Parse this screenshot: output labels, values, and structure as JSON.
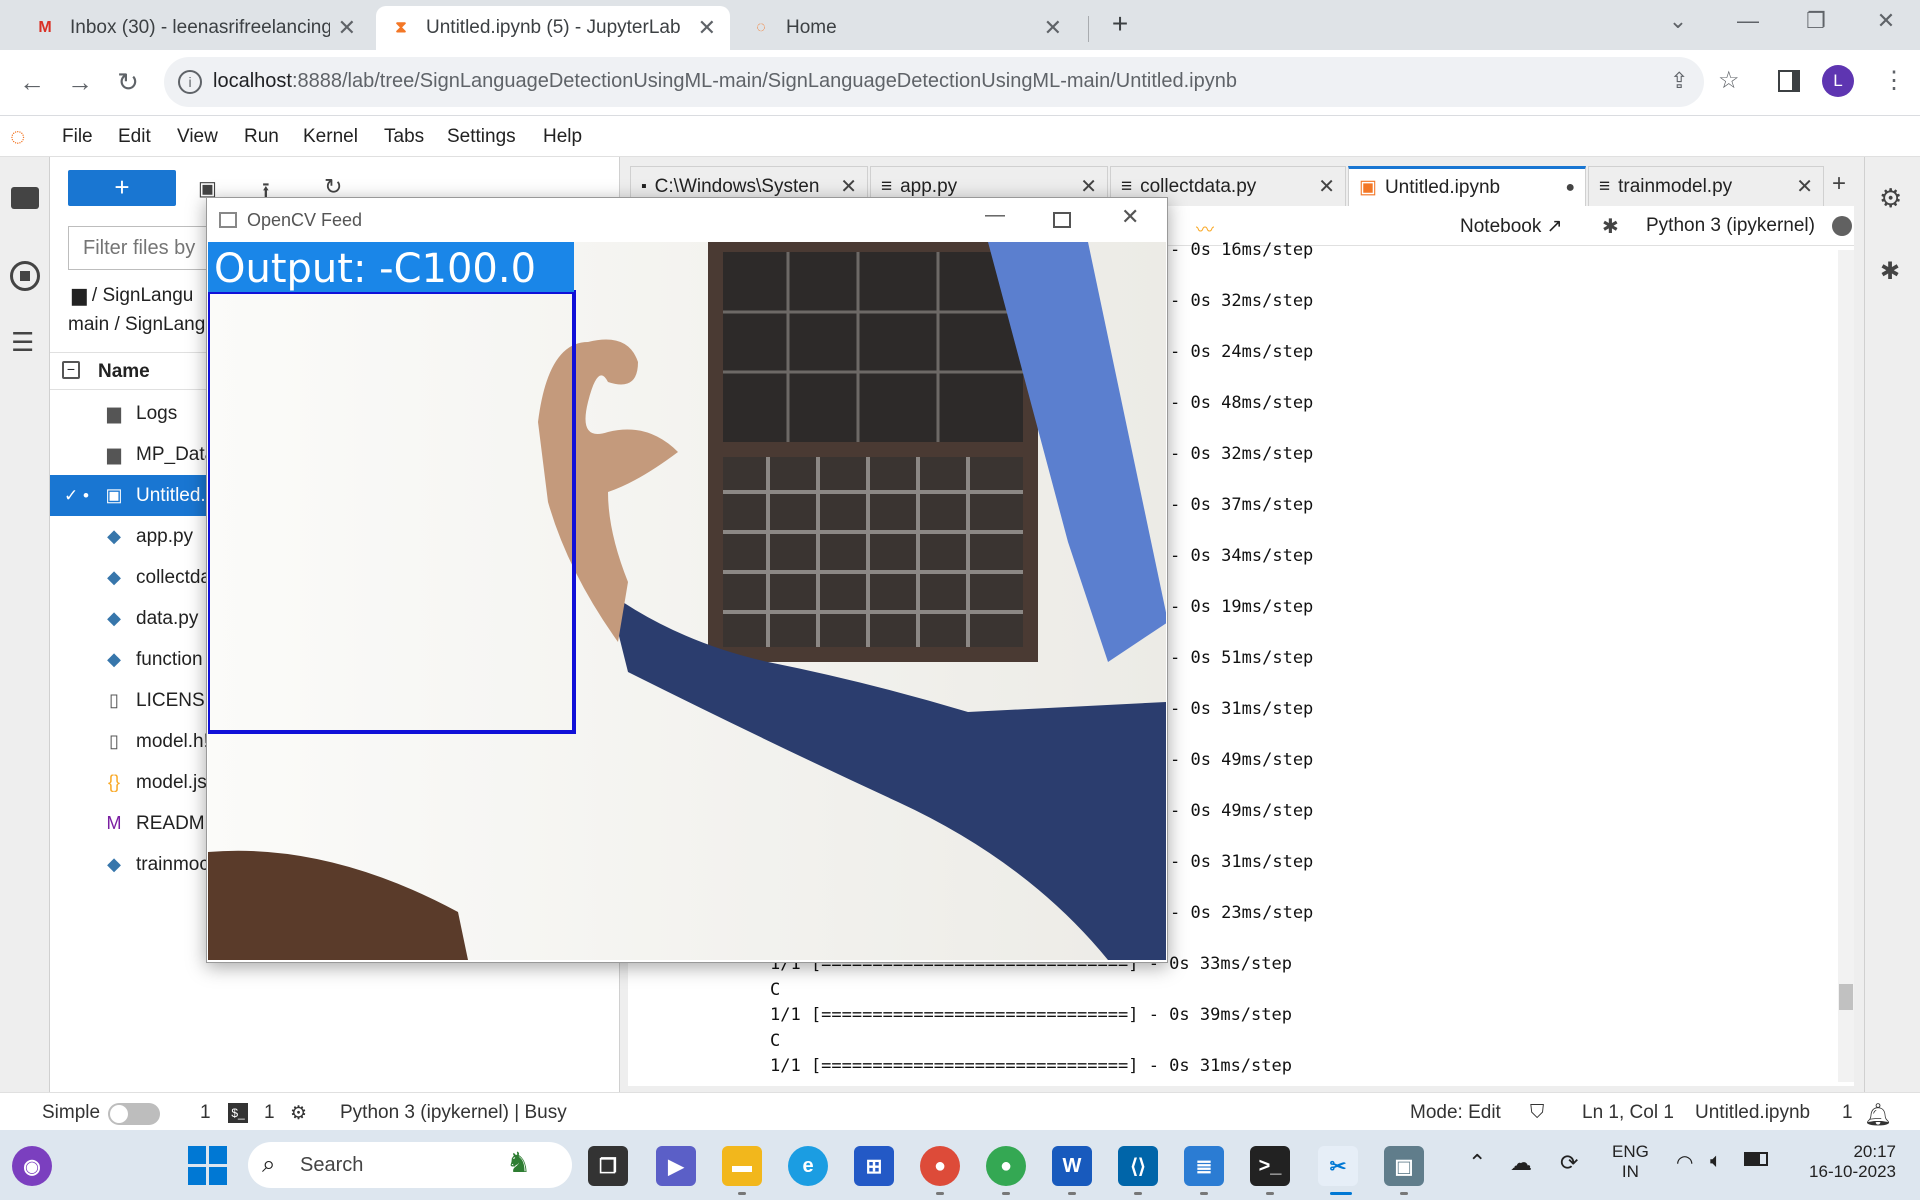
{
  "browser": {
    "tabs": [
      {
        "title": "Inbox (30) - leenasrifreelancing@",
        "icon": "gmail-icon"
      },
      {
        "title": "Untitled.ipynb (5) - JupyterLab",
        "icon": "hourglass-icon"
      },
      {
        "title": "Home",
        "icon": "jupyter-icon"
      }
    ],
    "url_host": "localhost",
    "url_path": ":8888/lab/tree/SignLanguageDetectionUsingML-main/SignLanguageDetectionUsingML-main/Untitled.ipynb",
    "profile_initial": "L"
  },
  "menu": [
    "File",
    "Edit",
    "View",
    "Run",
    "Kernel",
    "Tabs",
    "Settings",
    "Help"
  ],
  "filebrowser": {
    "new_label": "+",
    "filter_placeholder": "Filter files by",
    "path_line1": "/ SignLangu",
    "path_line2": "main / SignLang",
    "column_name": "Name",
    "files": [
      {
        "name": "Logs",
        "icon": "folder-icon"
      },
      {
        "name": "MP_Data",
        "icon": "folder-icon"
      },
      {
        "name": "Untitled.",
        "icon": "notebook-icon"
      },
      {
        "name": "app.py",
        "icon": "python-icon"
      },
      {
        "name": "collectda",
        "icon": "python-icon"
      },
      {
        "name": "data.py",
        "icon": "python-icon"
      },
      {
        "name": "function",
        "icon": "python-icon"
      },
      {
        "name": "LICENSE",
        "icon": "file-icon"
      },
      {
        "name": "model.h!",
        "icon": "file-icon"
      },
      {
        "name": "model.js",
        "icon": "json-icon"
      },
      {
        "name": "README",
        "icon": "markdown-icon"
      },
      {
        "name": "trainmoc",
        "icon": "python-icon"
      }
    ]
  },
  "doc_tabs": [
    {
      "title": "C:\\Windows\\Systen"
    },
    {
      "title": "app.py"
    },
    {
      "title": "collectdata.py"
    },
    {
      "title": "Untitled.ipynb"
    },
    {
      "title": "trainmodel.py"
    }
  ],
  "nb_toolbar": {
    "notebook_label": "Notebook",
    "kernel_label": "Python 3 (ipykernel)"
  },
  "output_lines": [
    "- 0s 16ms/step",
    "- 0s 32ms/step",
    "- 0s 24ms/step",
    "- 0s 48ms/step",
    "- 0s 32ms/step",
    "- 0s 37ms/step",
    "- 0s 34ms/step",
    "- 0s 19ms/step",
    "- 0s 51ms/step",
    "- 0s 31ms/step",
    "- 0s 49ms/step",
    "- 0s 49ms/step",
    "- 0s 31ms/step",
    "- 0s 23ms/step",
    "1/1 [==============================] - 0s 33ms/step",
    "C",
    "1/1 [==============================] - 0s 39ms/step",
    "C",
    "1/1 [==============================] - 0s 31ms/step"
  ],
  "opencv": {
    "title": "OpenCV Feed",
    "output_text": "Output: -C100.0"
  },
  "status": {
    "mode_label": "Simple",
    "count1": "1",
    "count2": "1",
    "kernel_status": "Python 3 (ipykernel) | Busy",
    "edit_mode": "Mode: Edit",
    "cursor": "Ln 1, Col 1",
    "filename": "Untitled.ipynb",
    "notif_count": "1"
  },
  "taskbar": {
    "search_label": "Search",
    "lang_line1": "ENG",
    "lang_line2": "IN",
    "time": "20:17",
    "date": "16-10-2023"
  }
}
